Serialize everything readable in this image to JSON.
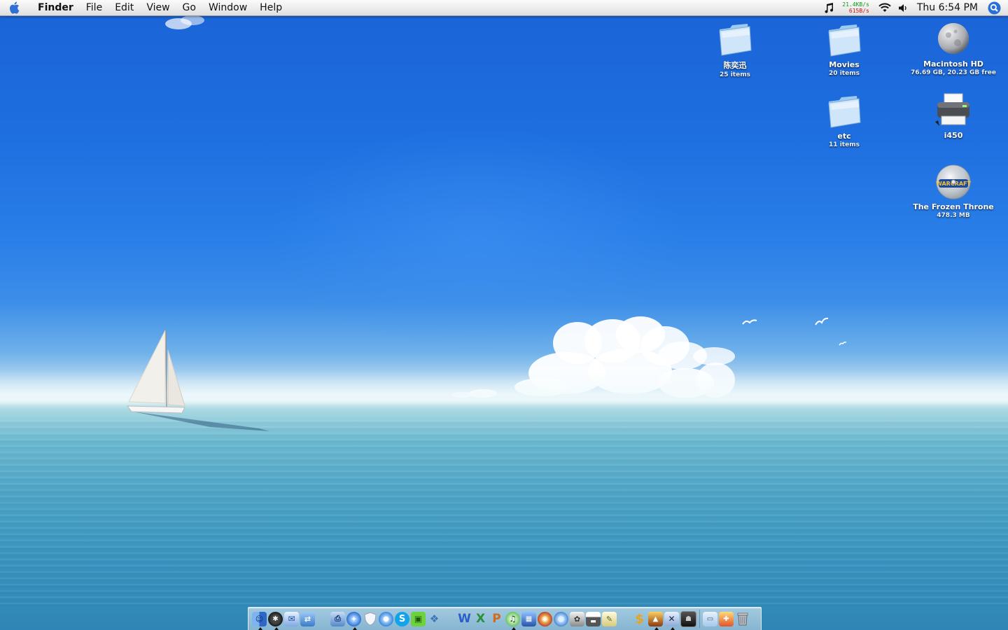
{
  "menubar": {
    "app_name": "Finder",
    "menus": [
      "File",
      "Edit",
      "View",
      "Go",
      "Window",
      "Help"
    ],
    "network": {
      "upload": "21.4KB/s",
      "download": "615B/s",
      "upload_color": "#0a9a14",
      "download_color": "#c81212"
    },
    "clock": "Thu 6:54 PM",
    "status_icons": [
      "itunes-note-icon",
      "network-monitor",
      "wifi-icon",
      "volume-icon",
      "spotlight-icon"
    ]
  },
  "desktop_icons": [
    {
      "name": "陈奕迅",
      "info": "25 items",
      "kind": "folder"
    },
    {
      "name": "Movies",
      "info": "20 items",
      "kind": "folder"
    },
    {
      "name": "Macintosh HD",
      "info": "76.69 GB, 20.23 GB free",
      "kind": "hard-disk"
    },
    {
      "name": "etc",
      "info": "11 items",
      "kind": "folder"
    },
    {
      "name": "i450",
      "info": "",
      "kind": "printer"
    },
    {
      "name": "The Frozen Throne",
      "info": "478.3 MB",
      "kind": "cd"
    },
    {
      "disc_art_text": "WARCRAFT"
    }
  ],
  "dock": {
    "apps": [
      {
        "icon": "finder-icon",
        "running": true
      },
      {
        "icon": "dashboard-icon",
        "running": true
      },
      {
        "icon": "mail-icon",
        "running": false
      },
      {
        "icon": "network-icon",
        "running": false
      },
      {
        "icon": "preview-icon",
        "running": false
      },
      {
        "icon": "safari-icon",
        "running": true
      },
      {
        "icon": "shield-icon",
        "running": false
      },
      {
        "icon": "ichat-icon",
        "running": false
      },
      {
        "icon": "skype-icon",
        "running": false
      },
      {
        "icon": "maze-icon",
        "running": false
      },
      {
        "icon": "kite-icon",
        "running": false
      },
      {
        "icon": "word-icon",
        "running": false
      },
      {
        "icon": "excel-icon",
        "running": false
      },
      {
        "icon": "powerpoint-icon",
        "running": false
      },
      {
        "icon": "itunes-icon",
        "running": true
      },
      {
        "icon": "iphoto-icon",
        "running": false
      },
      {
        "icon": "photo-booth-icon",
        "running": false
      },
      {
        "icon": "utility-icon",
        "running": false
      },
      {
        "icon": "photos-icon",
        "running": false
      },
      {
        "icon": "calendar-icon",
        "running": false
      },
      {
        "icon": "script-editor-icon",
        "running": false
      },
      {
        "icon": "dollar-icon",
        "running": false
      },
      {
        "icon": "game-icon",
        "running": true
      },
      {
        "icon": "tools-icon",
        "running": true
      },
      {
        "icon": "terminal-icon",
        "running": false
      }
    ],
    "docs": [
      {
        "icon": "applications-folder-icon"
      },
      {
        "icon": "pictures-folder-icon"
      },
      {
        "icon": "trash-icon"
      }
    ],
    "colors": {
      "finder": "#4a7fd8",
      "word": "#2a5fc8",
      "excel": "#2d8f3a",
      "powerpoint": "#d6691c",
      "skype": "#12a3e8",
      "itunes": "#5bbf53",
      "safari": "#2f6fd1",
      "dollar": "#e9a41c"
    }
  }
}
